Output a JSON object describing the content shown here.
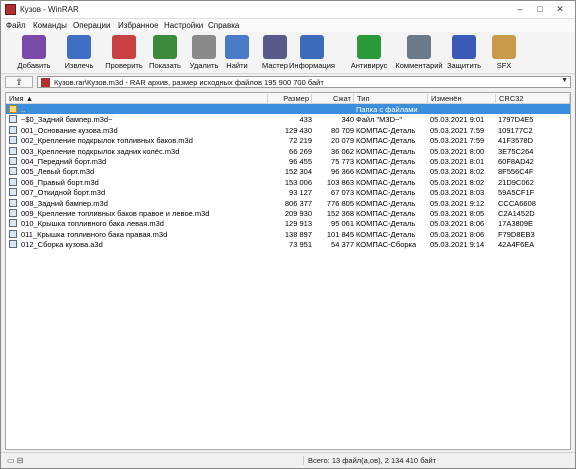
{
  "window": {
    "title": "Кузов - WinRAR",
    "controls": [
      "–",
      "□",
      "✕"
    ]
  },
  "menu": [
    "Файл",
    "Команды",
    "Операции",
    "Избранное",
    "Настройки",
    "Справка"
  ],
  "toolbar": [
    {
      "label": "Добавить",
      "icon": "add-archive-icon",
      "color": "#7a4aa8"
    },
    {
      "label": "Извлечь",
      "icon": "extract-icon",
      "color": "#3f6fc4"
    },
    {
      "label": "Проверить",
      "icon": "test-icon",
      "color": "#c84040"
    },
    {
      "label": "Показать",
      "icon": "view-icon",
      "color": "#3c8a3c"
    },
    {
      "label": "Удалить",
      "icon": "delete-icon",
      "color": "#8a8a8a"
    },
    {
      "label": "Найти",
      "icon": "find-icon",
      "color": "#4a7ac8"
    },
    {
      "label": "Мастер",
      "icon": "wizard-icon",
      "color": "#5a5a8a"
    },
    {
      "label": "Информация",
      "icon": "info-icon",
      "color": "#3a6ab8"
    },
    {
      "label": "Антивирус",
      "icon": "antivirus-icon",
      "color": "#2a9a3a"
    },
    {
      "label": "Комментарий",
      "icon": "comment-icon",
      "color": "#6a7a8a"
    },
    {
      "label": "Защитить",
      "icon": "protect-icon",
      "color": "#3a5ab8"
    },
    {
      "label": "SFX",
      "icon": "sfx-icon",
      "color": "#c89a4a"
    }
  ],
  "path": {
    "text": "Кузов.rar\\Кузов.m3d - RAR архив, размер исходных файлов 195 900 700 байт"
  },
  "columns": {
    "name": "Имя",
    "size": "Размер",
    "packed": "Сжат",
    "type": "Тип",
    "modified": "Изменён",
    "crc": "CRC32"
  },
  "rows": [
    {
      "name": "..",
      "size": "",
      "packed": "",
      "type": "Папка с файлами",
      "modified": "",
      "crc": "",
      "selected": true
    },
    {
      "name": "~$0_Задний бампер.m3d~",
      "size": "433",
      "packed": "340",
      "type": "Файл \"M3D~\"",
      "modified": "05.03.2021 9:01",
      "crc": "1797D4E5"
    },
    {
      "name": "001_Основание кузова.m3d",
      "size": "129 430",
      "packed": "80 709",
      "type": "КОМПАС-Деталь",
      "modified": "05.03.2021 7:59",
      "crc": "109177C2"
    },
    {
      "name": "002_Крепление подкрылок топливных баков.m3d",
      "size": "72 219",
      "packed": "20 079",
      "type": "КОМПАС-Деталь",
      "modified": "05.03.2021 7:59",
      "crc": "41F3578D"
    },
    {
      "name": "003_Крепление подкрылок задних колёс.m3d",
      "size": "66 269",
      "packed": "36 062",
      "type": "КОМПАС-Деталь",
      "modified": "05.03.2021 8:00",
      "crc": "3E75C264"
    },
    {
      "name": "004_Передний борт.m3d",
      "size": "96 455",
      "packed": "75 773",
      "type": "КОМПАС-Деталь",
      "modified": "05.03.2021 8:01",
      "crc": "60F8AD42"
    },
    {
      "name": "005_Левый борт.m3d",
      "size": "152 304",
      "packed": "96 366",
      "type": "КОМПАС-Деталь",
      "modified": "05.03.2021 8:02",
      "crc": "8F556C4F"
    },
    {
      "name": "006_Правый борт.m3d",
      "size": "153 006",
      "packed": "103 863",
      "type": "КОМПАС-Деталь",
      "modified": "05.03.2021 8:02",
      "crc": "21D9C062"
    },
    {
      "name": "007_Откидной борт.m3d",
      "size": "93 127",
      "packed": "67 073",
      "type": "КОМПАС-Деталь",
      "modified": "05.03.2021 8:03",
      "crc": "59A5CF1F"
    },
    {
      "name": "008_Задний бампер.m3d",
      "size": "806 377",
      "packed": "776 805",
      "type": "КОМПАС-Деталь",
      "modified": "05.03.2021 9:12",
      "crc": "CCCA6608"
    },
    {
      "name": "009_Крепление топливных баков правое и левое.m3d",
      "size": "209 930",
      "packed": "152 368",
      "type": "КОМПАС-Деталь",
      "modified": "05.03.2021 8:05",
      "crc": "C2A1452D"
    },
    {
      "name": "010_Крышка топливного бака левая.m3d",
      "size": "129 913",
      "packed": "95 061",
      "type": "КОМПАС-Деталь",
      "modified": "05.03.2021 8:06",
      "crc": "17A3809E"
    },
    {
      "name": "011_Крышка топливного бака правая.m3d",
      "size": "138 897",
      "packed": "101 845",
      "type": "КОМПАС-Деталь",
      "modified": "05.03.2021 8:06",
      "crc": "F79D8EB3"
    },
    {
      "name": "012_Сборка кузова.a3d",
      "size": "73 951",
      "packed": "54 377",
      "type": "КОМПАС-Сборка",
      "modified": "05.03.2021 9:14",
      "crc": "42A4F6EA"
    }
  ],
  "status": {
    "left_icons": "▭ ⊟",
    "text": "Всего: 13 файл(а,ов), 2 134 410 байт"
  }
}
